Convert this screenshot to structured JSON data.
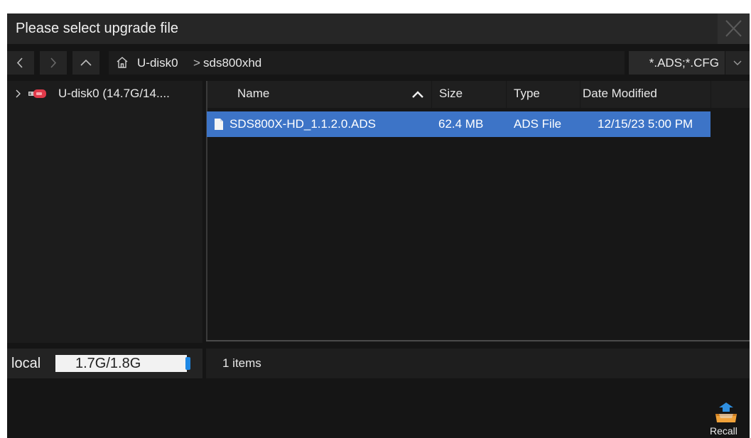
{
  "dialog": {
    "title": "Please select upgrade file"
  },
  "nav": {
    "path": [
      "U-disk0",
      "sds800xhd"
    ],
    "separator": ">",
    "filter": "*.ADS;*.CFG"
  },
  "tree": {
    "items": [
      {
        "label": "U-disk0  (14.7G/14...."
      }
    ]
  },
  "file_list": {
    "columns": [
      "Name",
      "Size",
      "Type",
      "Date Modified"
    ],
    "sort_column": "Name",
    "sort_order": "ascending",
    "rows": [
      {
        "name": "SDS800X-HD_1.1.2.0.ADS",
        "size": "62.4 MB",
        "type": "ADS File",
        "modified": "12/15/23 5:00 PM",
        "selected": true
      }
    ],
    "count_text": "1 items"
  },
  "storage": {
    "label": "local",
    "usage": "1.7G/1.8G"
  },
  "actions": {
    "recall_label": "Recall"
  },
  "colors": {
    "selection": "#3d74c7",
    "usb_icon": "#e03a4a",
    "storage_indicator": "#1e88e5",
    "recall_icon_tray": "#f0a23a",
    "recall_icon_arrow": "#2f8fe0"
  },
  "icons": [
    "close-icon",
    "chevron-left-icon",
    "chevron-right-icon",
    "chevron-up-icon",
    "home-icon",
    "chevron-down-icon",
    "usb-drive-icon",
    "file-icon",
    "sort-ascending-icon",
    "recall-icon"
  ]
}
